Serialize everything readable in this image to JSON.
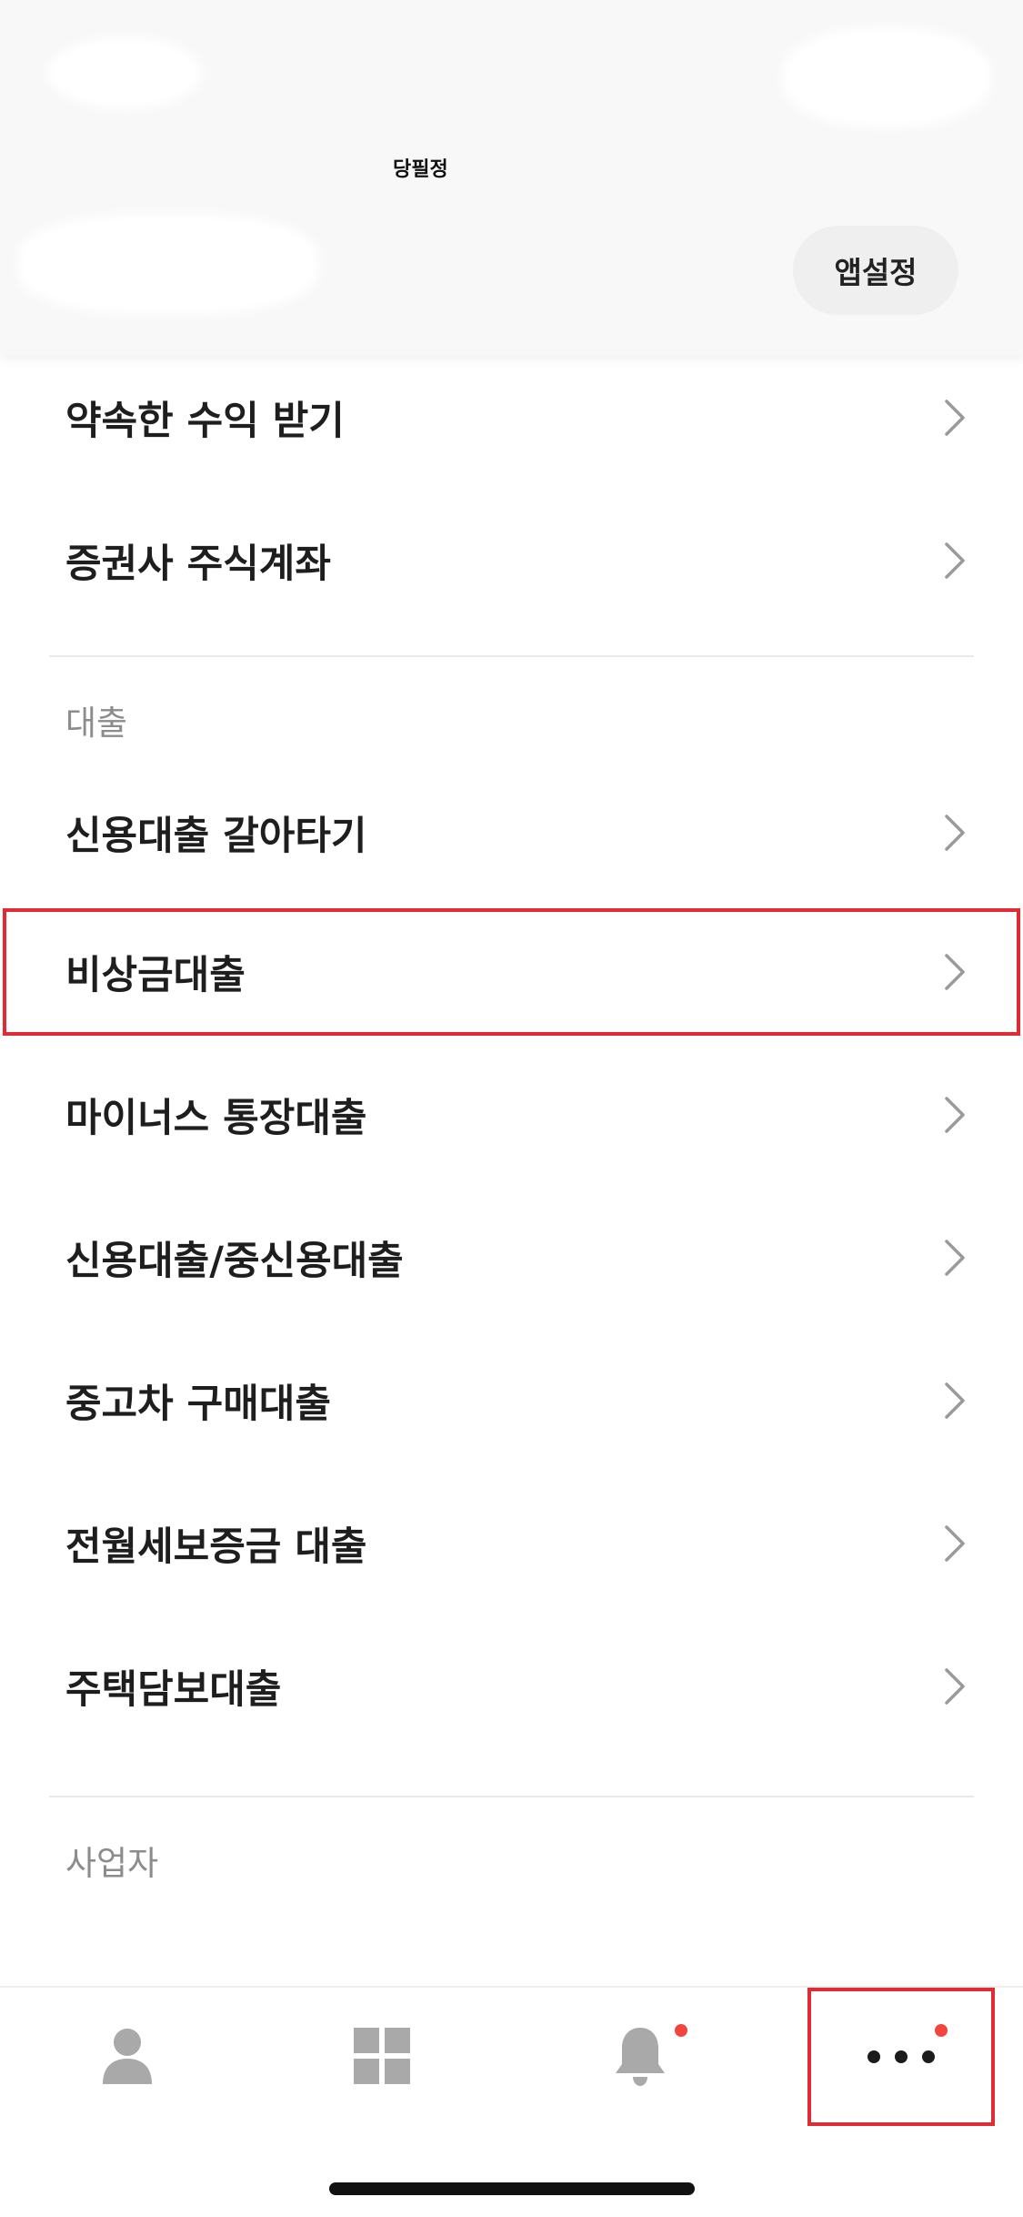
{
  "header": {
    "title": "당필정",
    "app_settings_label": "앱설정"
  },
  "menu": {
    "investment_items": [
      {
        "label": "약속한 수익 받기"
      },
      {
        "label": "증권사 주식계좌"
      }
    ],
    "loan_section": {
      "title": "대출",
      "items": [
        {
          "label": "신용대출 갈아타기"
        },
        {
          "label": "비상금대출"
        },
        {
          "label": "마이너스 통장대출"
        },
        {
          "label": "신용대출/중신용대출"
        },
        {
          "label": "중고차 구매대출"
        },
        {
          "label": "전월세보증금 대출"
        },
        {
          "label": "주택담보대출"
        }
      ]
    },
    "business_section": {
      "title": "사업자"
    }
  },
  "tabbar": {
    "tabs": [
      {
        "icon": "person-icon",
        "has_badge": false
      },
      {
        "icon": "grid-icon",
        "has_badge": false
      },
      {
        "icon": "bell-icon",
        "has_badge": true
      },
      {
        "icon": "more-icon",
        "has_badge": true
      }
    ],
    "badge_color": "#f2453d"
  },
  "colors": {
    "highlight": "#e02b34",
    "header_bg": "#f8f8f8",
    "icon_gray": "#a9a9a9"
  }
}
